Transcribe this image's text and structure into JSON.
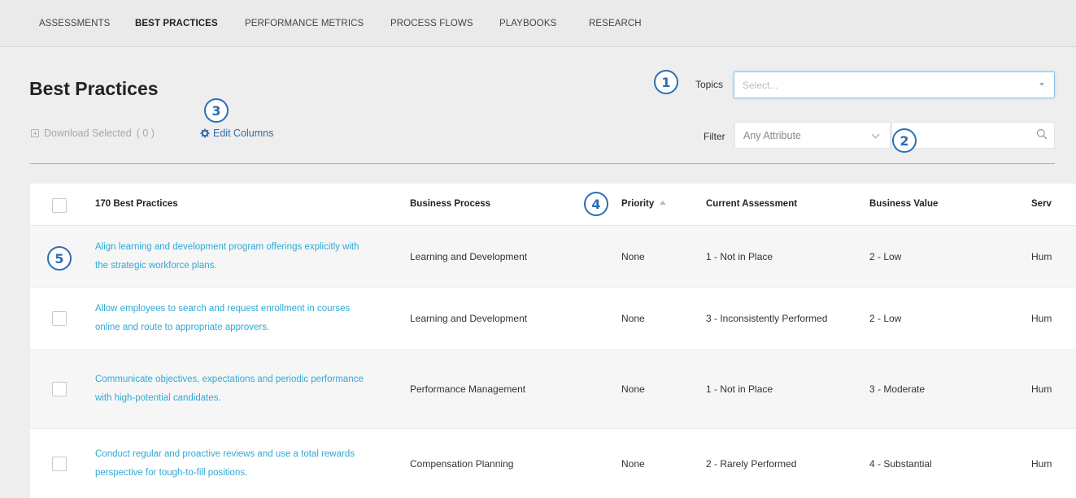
{
  "nav": {
    "items": [
      "ASSESSMENTS",
      "BEST PRACTICES",
      "PERFORMANCE METRICS",
      "PROCESS FLOWS",
      "PLAYBOOKS",
      "RESEARCH"
    ],
    "active": "BEST PRACTICES"
  },
  "page": {
    "title": "Best Practices"
  },
  "toolbar": {
    "download_label": "Download Selected",
    "download_count": "( 0 )",
    "edit_columns_label": "Edit Columns"
  },
  "topics": {
    "label": "Topics",
    "placeholder": "Select..."
  },
  "filter": {
    "label": "Filter",
    "selected": "Any Attribute",
    "search_value": ""
  },
  "table": {
    "headers": {
      "title": "170 Best Practices",
      "process": "Business Process",
      "priority": "Priority",
      "assessment": "Current Assessment",
      "value": "Business Value",
      "service": "Serv"
    },
    "rows": [
      {
        "title": "Align learning and development program offerings explicitly with the strategic workforce plans.",
        "process": "Learning and Development",
        "priority": "None",
        "assessment": "1 - Not in Place",
        "value": "2 - Low",
        "service": "Hum"
      },
      {
        "title": "Allow employees to search and request enrollment in courses online and route to appropriate approvers.",
        "process": "Learning and Development",
        "priority": "None",
        "assessment": "3 - Inconsistently Performed",
        "value": "2 - Low",
        "service": "Hum"
      },
      {
        "title": "Communicate objectives, expectations and periodic performance with high-potential candidates.",
        "process": "Performance Management",
        "priority": "None",
        "assessment": "1 - Not in Place",
        "value": "3 - Moderate",
        "service": "Hum"
      },
      {
        "title": "Conduct regular and proactive reviews and use a total rewards perspective for tough-to-fill positions.",
        "process": "Compensation Planning",
        "priority": "None",
        "assessment": "2 - Rarely Performed",
        "value": "4 - Substantial",
        "service": "Hum"
      }
    ]
  },
  "callouts": [
    "1",
    "2",
    "3",
    "4",
    "5"
  ],
  "colors": {
    "link": "#2fa9d4",
    "accent": "#2e6ea6",
    "callout": "#2a6fb5"
  }
}
